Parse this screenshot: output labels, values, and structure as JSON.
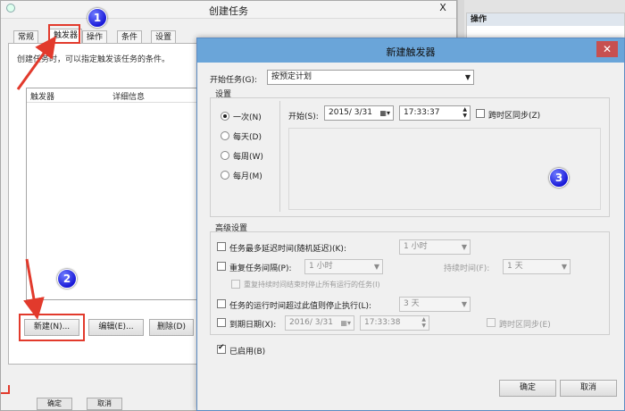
{
  "bg_window": {
    "title": "创建任务",
    "close": "X",
    "tabs": [
      "常规",
      "触发器",
      "操作",
      "条件",
      "设置"
    ],
    "hint": "创建任务时，可以指定触发该任务的条件。",
    "list_cols": [
      "触发器",
      "详细信息"
    ],
    "buttons": {
      "new": "新建(N)...",
      "edit": "编辑(E)...",
      "delete": "删除(D)"
    },
    "bottom_buttons": {
      "ok": "确定",
      "cancel": "取消"
    }
  },
  "actions_pane": {
    "title": "操作"
  },
  "dialog": {
    "title": "新建触发器",
    "close": "✕",
    "begin_label": "开始任务(G):",
    "begin_value": "按预定计划",
    "settings_label": "设置",
    "radios": [
      "一次(N)",
      "每天(D)",
      "每周(W)",
      "每月(M)"
    ],
    "start_label": "开始(S):",
    "start_date": "2015/ 3/31",
    "start_time": "17:33:37",
    "sync_label": "跨时区同步(Z)",
    "advanced_label": "高级设置",
    "delay_label": "任务最多延迟时间(随机延迟)(K):",
    "delay_value": "1 小时",
    "repeat_label": "重复任务间隔(P):",
    "repeat_value": "1 小时",
    "duration_label": "持续时间(F):",
    "duration_value": "1 天",
    "stop_at_end_label": "重复持续时间结束时停止所有运行的任务(I)",
    "stop_longer_label": "任务的运行时间超过此值则停止执行(L):",
    "stop_longer_value": "3 天",
    "expire_label": "到期日期(X):",
    "expire_date": "2016/ 3/31",
    "expire_time": "17:33:38",
    "expire_sync_label": "跨时区同步(E)",
    "enabled_label": "已启用(B)",
    "ok": "确定",
    "cancel": "取消"
  },
  "markers": [
    "1",
    "2",
    "3"
  ]
}
